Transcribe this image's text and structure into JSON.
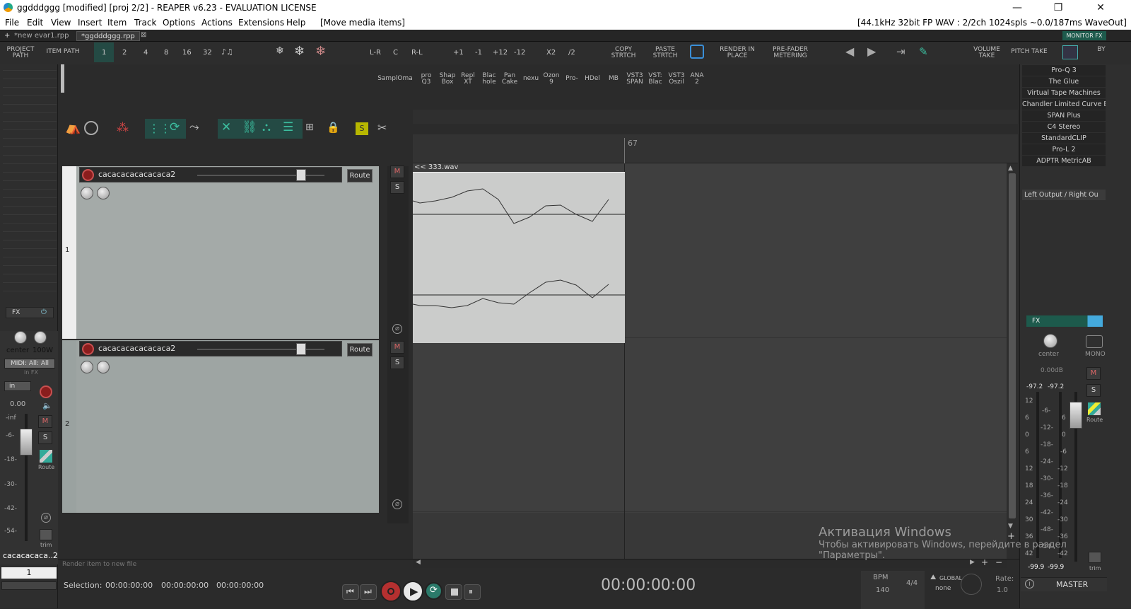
{
  "window": {
    "title": "ggdddggg [modified] [proj 2/2] - REAPER v6.23 - EVALUATION LICENSE",
    "min_glyph": "—",
    "max_glyph": "❐",
    "close_glyph": "✕"
  },
  "menu": {
    "items": [
      "File",
      "Edit",
      "View",
      "Insert",
      "Item",
      "Track",
      "Options",
      "Actions",
      "Extensions",
      "Help"
    ],
    "action_hint": "[Move media items]",
    "audio_info": "[44.1kHz 32bit FP WAV : 2/2ch 1024spls ~0.0/187ms WaveOut]"
  },
  "tabs": {
    "plus": "+",
    "items": [
      "*new evar1.rpp",
      "*ggdddggg.rpp"
    ],
    "close_glyph": "⊠",
    "monitor_fx": "MONITOR FX"
  },
  "toolbar": {
    "project_path": "PROJECT PATH",
    "item_path": "ITEM PATH",
    "grid_numbers": [
      "1",
      "2",
      "4",
      "8",
      "16",
      "32"
    ],
    "pan_buttons": [
      "L-R",
      "C",
      "R-L"
    ],
    "pitch_buttons": [
      "+1",
      "-1",
      "+12",
      "-12"
    ],
    "rate_buttons": [
      "X2",
      "/2"
    ],
    "copy_stretch": "COPY STRTCH",
    "paste_stretch": "PASTE STRTCH",
    "render_in_place": "RENDER IN PLACE",
    "pre_fader_metering": "PRE-FADER METERING",
    "volume_take": "VOLUME TAKE",
    "pitch_take": "PITCH TAKE",
    "by": "BY"
  },
  "fx_toolbar": {
    "buttons": [
      "SamplOma",
      "pro Q3",
      "Shap Box",
      "Repl XT",
      "Blac hole",
      "Pan Cake",
      "nexu",
      "Ozon 9",
      "Pro-",
      "HDel",
      "MB",
      "VST3 SPAN",
      "VST: Blac",
      "VST3 Oszil",
      "ANA 2"
    ]
  },
  "fx_list": [
    "Pro-Q 3",
    "The Glue",
    "Virtual Tape Machines",
    "Chandler Limited Curve B",
    "SPAN Plus",
    "C4 Stereo",
    "StandardCLIP",
    "Pro-L 2",
    "ADPTR MetricAB"
  ],
  "output_routing": "Left Output / Right Ou",
  "ruler": {
    "marker": "67"
  },
  "tracks": [
    {
      "name": "cacacacacacacaca2",
      "number": "1",
      "route": "Route"
    },
    {
      "name": "cacacacacacacaca2",
      "number": "2",
      "route": "Route"
    }
  ],
  "item": {
    "label": "<< 333.wav"
  },
  "mixer_left": {
    "fx": "FX",
    "pan": "center",
    "width": "100W",
    "midi": "MIDI: All: All",
    "in_fx": "in FX",
    "in": "in",
    "volume": "0.00",
    "scale": [
      "-inf",
      "-6-",
      "-18-",
      "-30-",
      "-42-",
      "-54-"
    ],
    "route": "Route",
    "trim": "trim",
    "track_name": "cacacacaca..2",
    "track_number": "1"
  },
  "master": {
    "fx": "FX",
    "pan": "center",
    "mono": "MONO",
    "volume": "0.00dB",
    "peak_l": "-97.2",
    "peak_r": "-97.2",
    "rms_l": "-99.9",
    "rms_r": "-99.9",
    "scale_left": [
      "12",
      "6",
      "0",
      "6",
      "12",
      "18",
      "24",
      "30",
      "36",
      "42"
    ],
    "scale_mid": [
      "-6-",
      "-12-",
      "-18-",
      "-24-",
      "-30-",
      "-36-",
      "-42-",
      "-48-",
      "-54-"
    ],
    "scale_right": [
      "6",
      "0",
      "-6",
      "-12",
      "-18",
      "-24",
      "-30",
      "-36",
      "-42"
    ],
    "route": "Route",
    "trim": "trim",
    "label": "MASTER"
  },
  "status": {
    "render_hint": "Render item to new file",
    "selection_label": "Selection:",
    "sel_start": "00:00:00:00",
    "sel_end": "00:00:00:00",
    "sel_length": "00:00:00:00",
    "time": "00:00:00:00",
    "bpm_label": "BPM",
    "bpm": "140",
    "time_sig": "4/4",
    "global": "GLOBAL",
    "none": "none",
    "rate_label": "Rate:",
    "rate": "1.0"
  },
  "watermark": {
    "line1": "Активация Windows",
    "line2": "Чтобы активировать Windows, перейдите в раздел",
    "line3": "\"Параметры\"."
  }
}
